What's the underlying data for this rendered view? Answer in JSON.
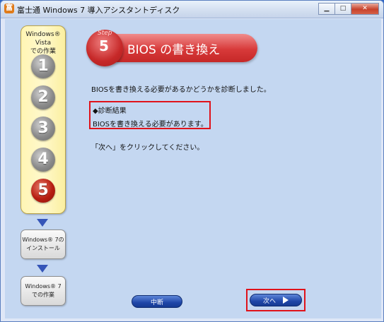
{
  "window": {
    "title": "富士通 Windows 7 導入アシスタントディスク",
    "icon": "fujitsu-app-icon",
    "controls": [
      "minimize",
      "maximize",
      "close"
    ]
  },
  "steps_panel": {
    "header": "Windows® Vista\nでの作業",
    "steps": [
      "1",
      "2",
      "3",
      "4",
      "5"
    ],
    "active_step": "5"
  },
  "side_boxes": {
    "install": "Windows® 7の\nインストール",
    "work": "Windows® 7\nでの作業"
  },
  "banner": {
    "step_word": "Step",
    "step_number": "5",
    "title": "BIOS の書き換え"
  },
  "main": {
    "intro": "BIOSを書き換える必要があるかどうかを診断しました。",
    "result_heading": "◆診断結果",
    "result_text": "BIOSを書き換える必要があります。",
    "instruction": "「次へ」をクリックしてください。"
  },
  "buttons": {
    "abort": "中断",
    "next": "次へ"
  },
  "colors": {
    "accent_red": "#d83a3a",
    "button_blue": "#1f46a8",
    "highlight_red": "#e0121a",
    "panel_yellow": "#fff5b4"
  }
}
